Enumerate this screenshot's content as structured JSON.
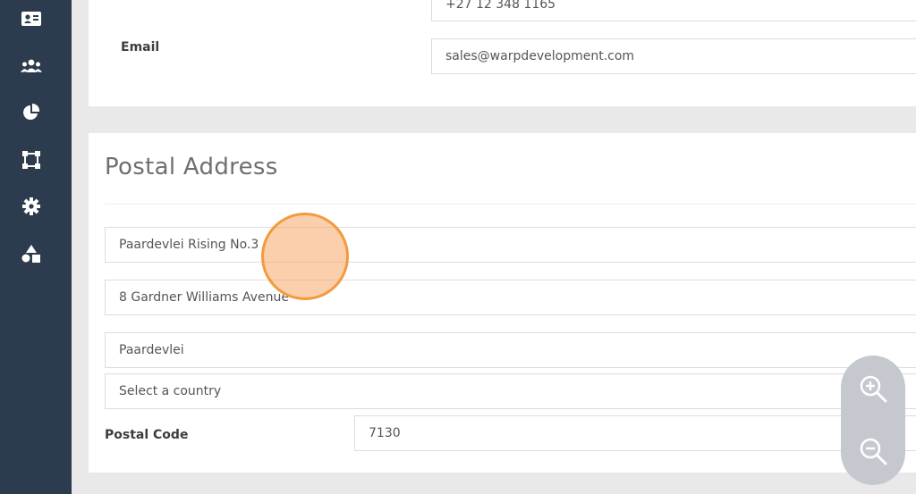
{
  "sidebar": {
    "items": [
      {
        "icon": "contact-card-icon"
      },
      {
        "icon": "users-icon"
      },
      {
        "icon": "pie-chart-icon"
      },
      {
        "icon": "vector-square-icon"
      },
      {
        "icon": "gear-icon"
      },
      {
        "icon": "shapes-icon"
      }
    ]
  },
  "contact": {
    "telephone_value": "+27 12 348 1165",
    "email_label": "Email",
    "email_value": "sales@warpdevelopment.com"
  },
  "postal": {
    "title": "Postal Address",
    "line1": "Paardevlei Rising No.3",
    "line2": "8 Gardner Williams Avenue",
    "line3": "Paardevlei",
    "country_placeholder": "Select a country",
    "postal_code_label": "Postal Code",
    "postal_code_value": "7130"
  },
  "zoom": {
    "in_icon": "zoom-in-icon",
    "out_icon": "zoom-out-icon"
  },
  "colors": {
    "sidebar": "#2c3b4d",
    "cursor_highlight": "#f39a3c"
  }
}
